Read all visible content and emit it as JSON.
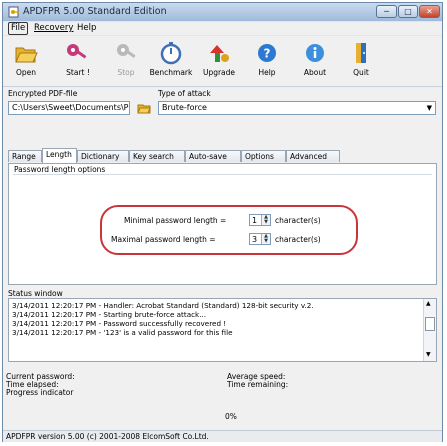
{
  "window": {
    "title": "APDFPR 5.00 Standard Edition"
  },
  "menu": {
    "file": "File",
    "recovery": "Recovery",
    "help": "Help"
  },
  "toolbar": {
    "open": "Open",
    "start": "Start !",
    "stop": "Stop",
    "benchmark": "Benchmark",
    "upgrade": "Upgrade",
    "help": "Help",
    "about": "About",
    "quit": "Quit"
  },
  "encrypted": {
    "label": "Encrypted PDF-file",
    "path": "C:\\Users\\Sweet\\Documents\\PDF.pd"
  },
  "attack": {
    "label": "Type of attack",
    "value": "Brute-force"
  },
  "tabs": [
    "Range",
    "Length",
    "Dictionary",
    "Key search",
    "Auto-save",
    "Options",
    "Advanced"
  ],
  "length": {
    "group_title": "Password length options",
    "min_label": "Minimal password length =",
    "min_value": "1",
    "max_label": "Maximal password length =",
    "max_value": "3",
    "unit": "character(s)"
  },
  "status": {
    "title": "Status window",
    "lines": [
      "3/14/2011 12:20:17 PM - Handler: Acrobat Standard (Standard) 128-bit security v.2.",
      "3/14/2011 12:20:17 PM - Starting brute-force attack...",
      "3/14/2011 12:20:17 PM - Password successfully recovered !",
      "3/14/2011 12:20:17 PM - '123' is a valid password for this file"
    ]
  },
  "info": {
    "current_password": "Current password:",
    "time_elapsed": "Time elapsed:",
    "progress": "Progress indicator",
    "average_speed": "Average speed:",
    "time_remaining": "Time remaining:",
    "percent": "0%"
  },
  "footer": "APDFPR version 5.00 (c) 2001-2008 ElcomSoft Co.Ltd.",
  "colors": {
    "accent_circle": "#c8353a",
    "titlebar": "#b7cde6",
    "close": "#c4442c"
  }
}
